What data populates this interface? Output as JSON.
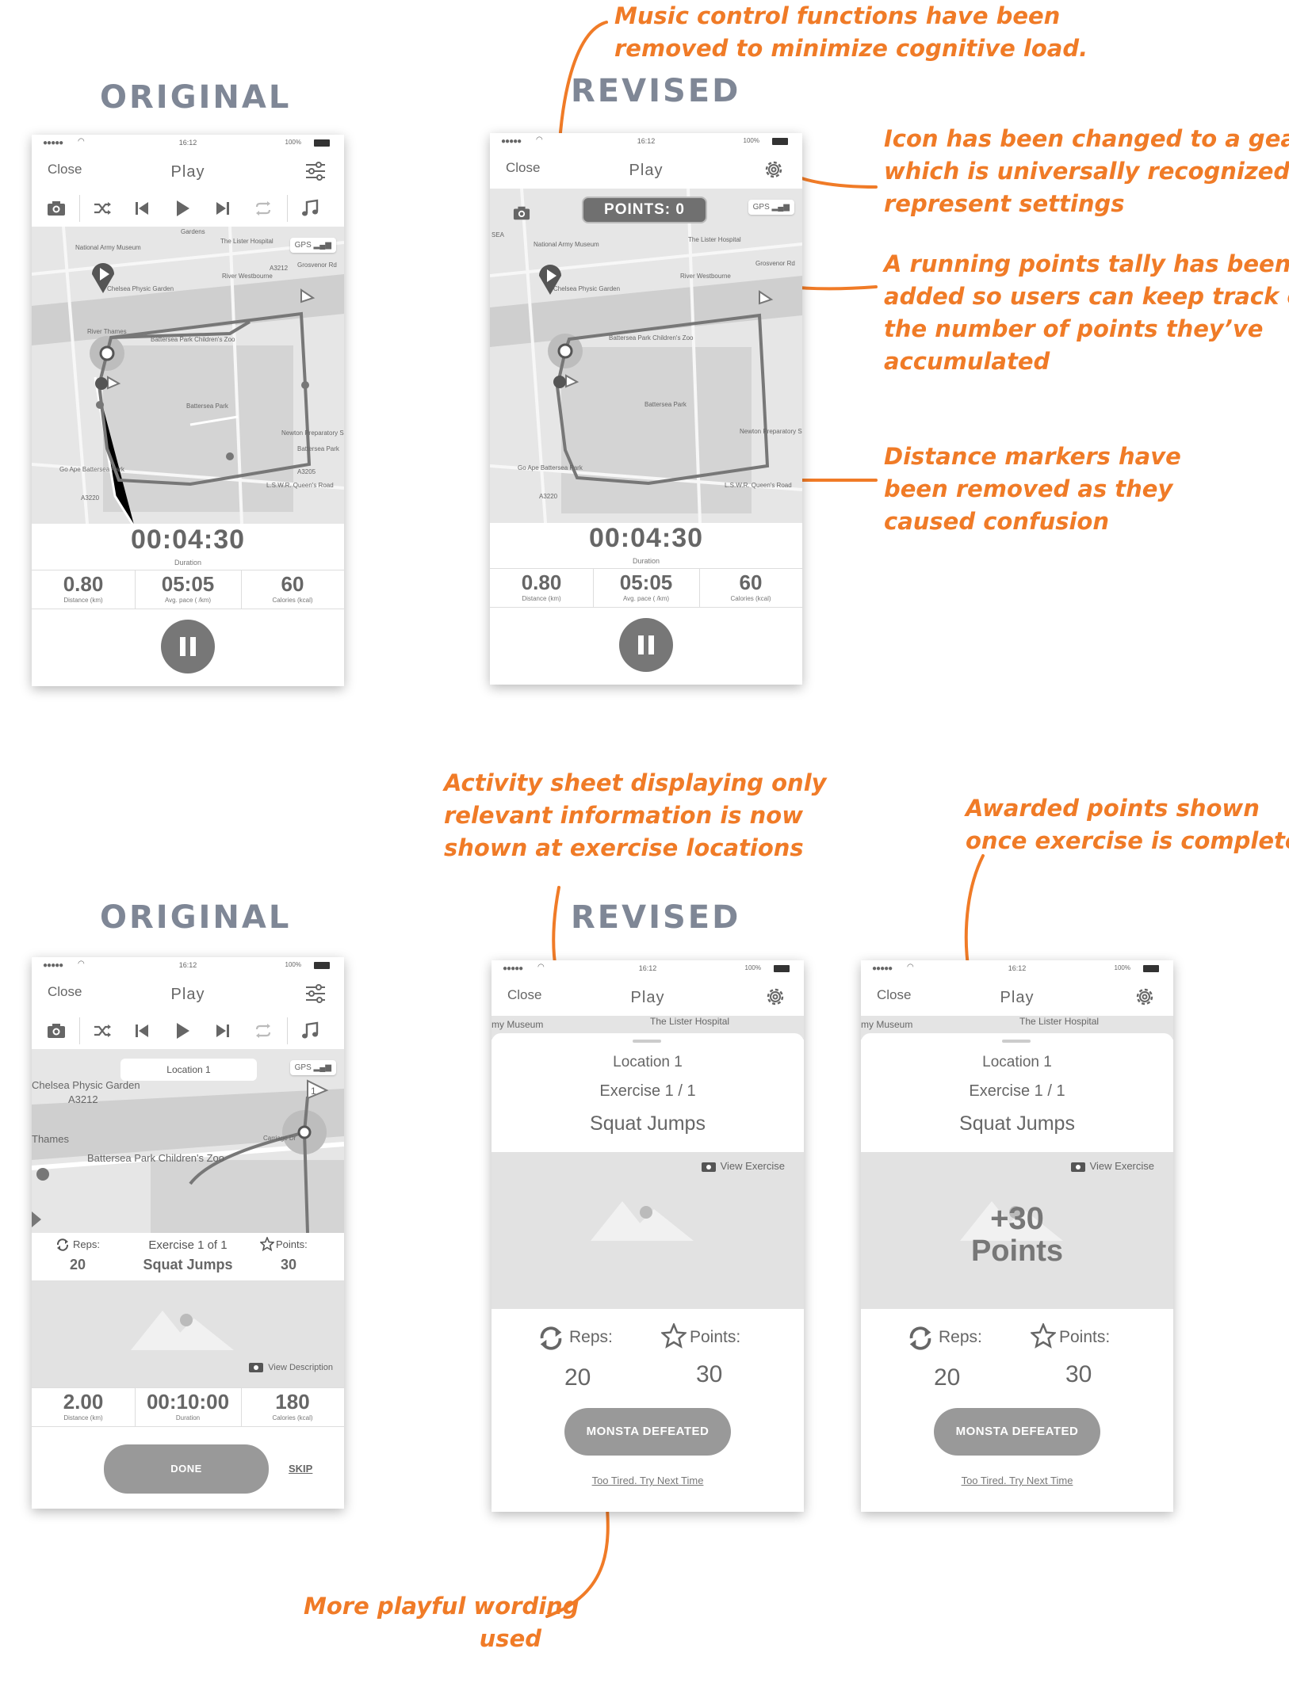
{
  "headings": {
    "top_original": "ORIGINAL",
    "top_revised": "REVISED",
    "bottom_original": "ORIGINAL",
    "bottom_revised": "REVISED"
  },
  "notes": {
    "music": [
      "Music control functions have been",
      "removed to minimize cognitive load."
    ],
    "gear": [
      "Icon has been changed to a gear,",
      "which is universally recognized to",
      "represent settings"
    ],
    "points": [
      "A running points tally has been",
      "added so users can keep track of",
      "the number of points they’ve",
      "accumulated"
    ],
    "distance": [
      "Distance markers have",
      "been removed as they",
      "caused confusion"
    ],
    "activity": [
      "Activity sheet displaying only",
      "relevant information is now",
      "shown at exercise locations"
    ],
    "awarded": [
      "Awarded points shown",
      "once exercise is complete"
    ],
    "wording": [
      "More playful wording",
      "used"
    ]
  },
  "status": {
    "time": "16:12",
    "battery": "100%",
    "dots": "●●●●●"
  },
  "nav": {
    "close": "Close",
    "title": "Play"
  },
  "map": {
    "gps": "GPS",
    "labels": [
      "Gardens",
      "National Army Museum",
      "The Lister Hospital",
      "Grosvenor Rd",
      "A3212",
      "River Westbourne",
      "Chelsea Physic Garden",
      "River Thames",
      "Battersea Park Children's Zoo",
      "Battersea Park",
      "Newton Preparatory School",
      "Battersea Park",
      "Go Ape Battersea Park",
      "L.S.W.R. Queen's Road",
      "A3220",
      "A3205",
      "SEA"
    ]
  },
  "run": {
    "duration": "00:04:30",
    "duration_label": "Duration",
    "distance": "0.80",
    "distance_label": "Distance (km)",
    "pace": "05:05",
    "pace_label": "Avg. pace ( /km)",
    "calories": "60",
    "calories_label": "Calories (kcal)"
  },
  "points_pill": "POINTS: 0",
  "exercise_original": {
    "location_chip": "Location 1",
    "map_labels": [
      "Chelsea Physic Garden",
      "A3212",
      "Thames",
      "Battersea Park Children's Zoo",
      "Carriage Dr"
    ],
    "reps_label": "Reps:",
    "reps": "20",
    "exercise_line": "Exercise 1 of 1",
    "exercise_name": "Squat Jumps",
    "points_label": "Points:",
    "points": "30",
    "view_description": "View Description",
    "distance": "2.00",
    "distance_label": "Distance (km)",
    "duration": "00:10:00",
    "duration_label": "Duration",
    "calories": "180",
    "calories_label": "Calories (kcal)",
    "done": "DONE",
    "skip": "SKIP",
    "flag_number": "1"
  },
  "exercise_revised": {
    "map_labels": [
      "my Museum",
      "The Lister Hospital"
    ],
    "location": "Location 1",
    "exercise": "Exercise 1 / 1",
    "name": "Squat Jumps",
    "view_exercise": "View Exercise",
    "reps_label": "Reps:",
    "reps": "20",
    "points_label": "Points:",
    "points": "30",
    "button": "MONSTA DEFEATED",
    "link": "Too Tired. Try Next Time",
    "award_value": "+30",
    "award_unit": "Points"
  }
}
